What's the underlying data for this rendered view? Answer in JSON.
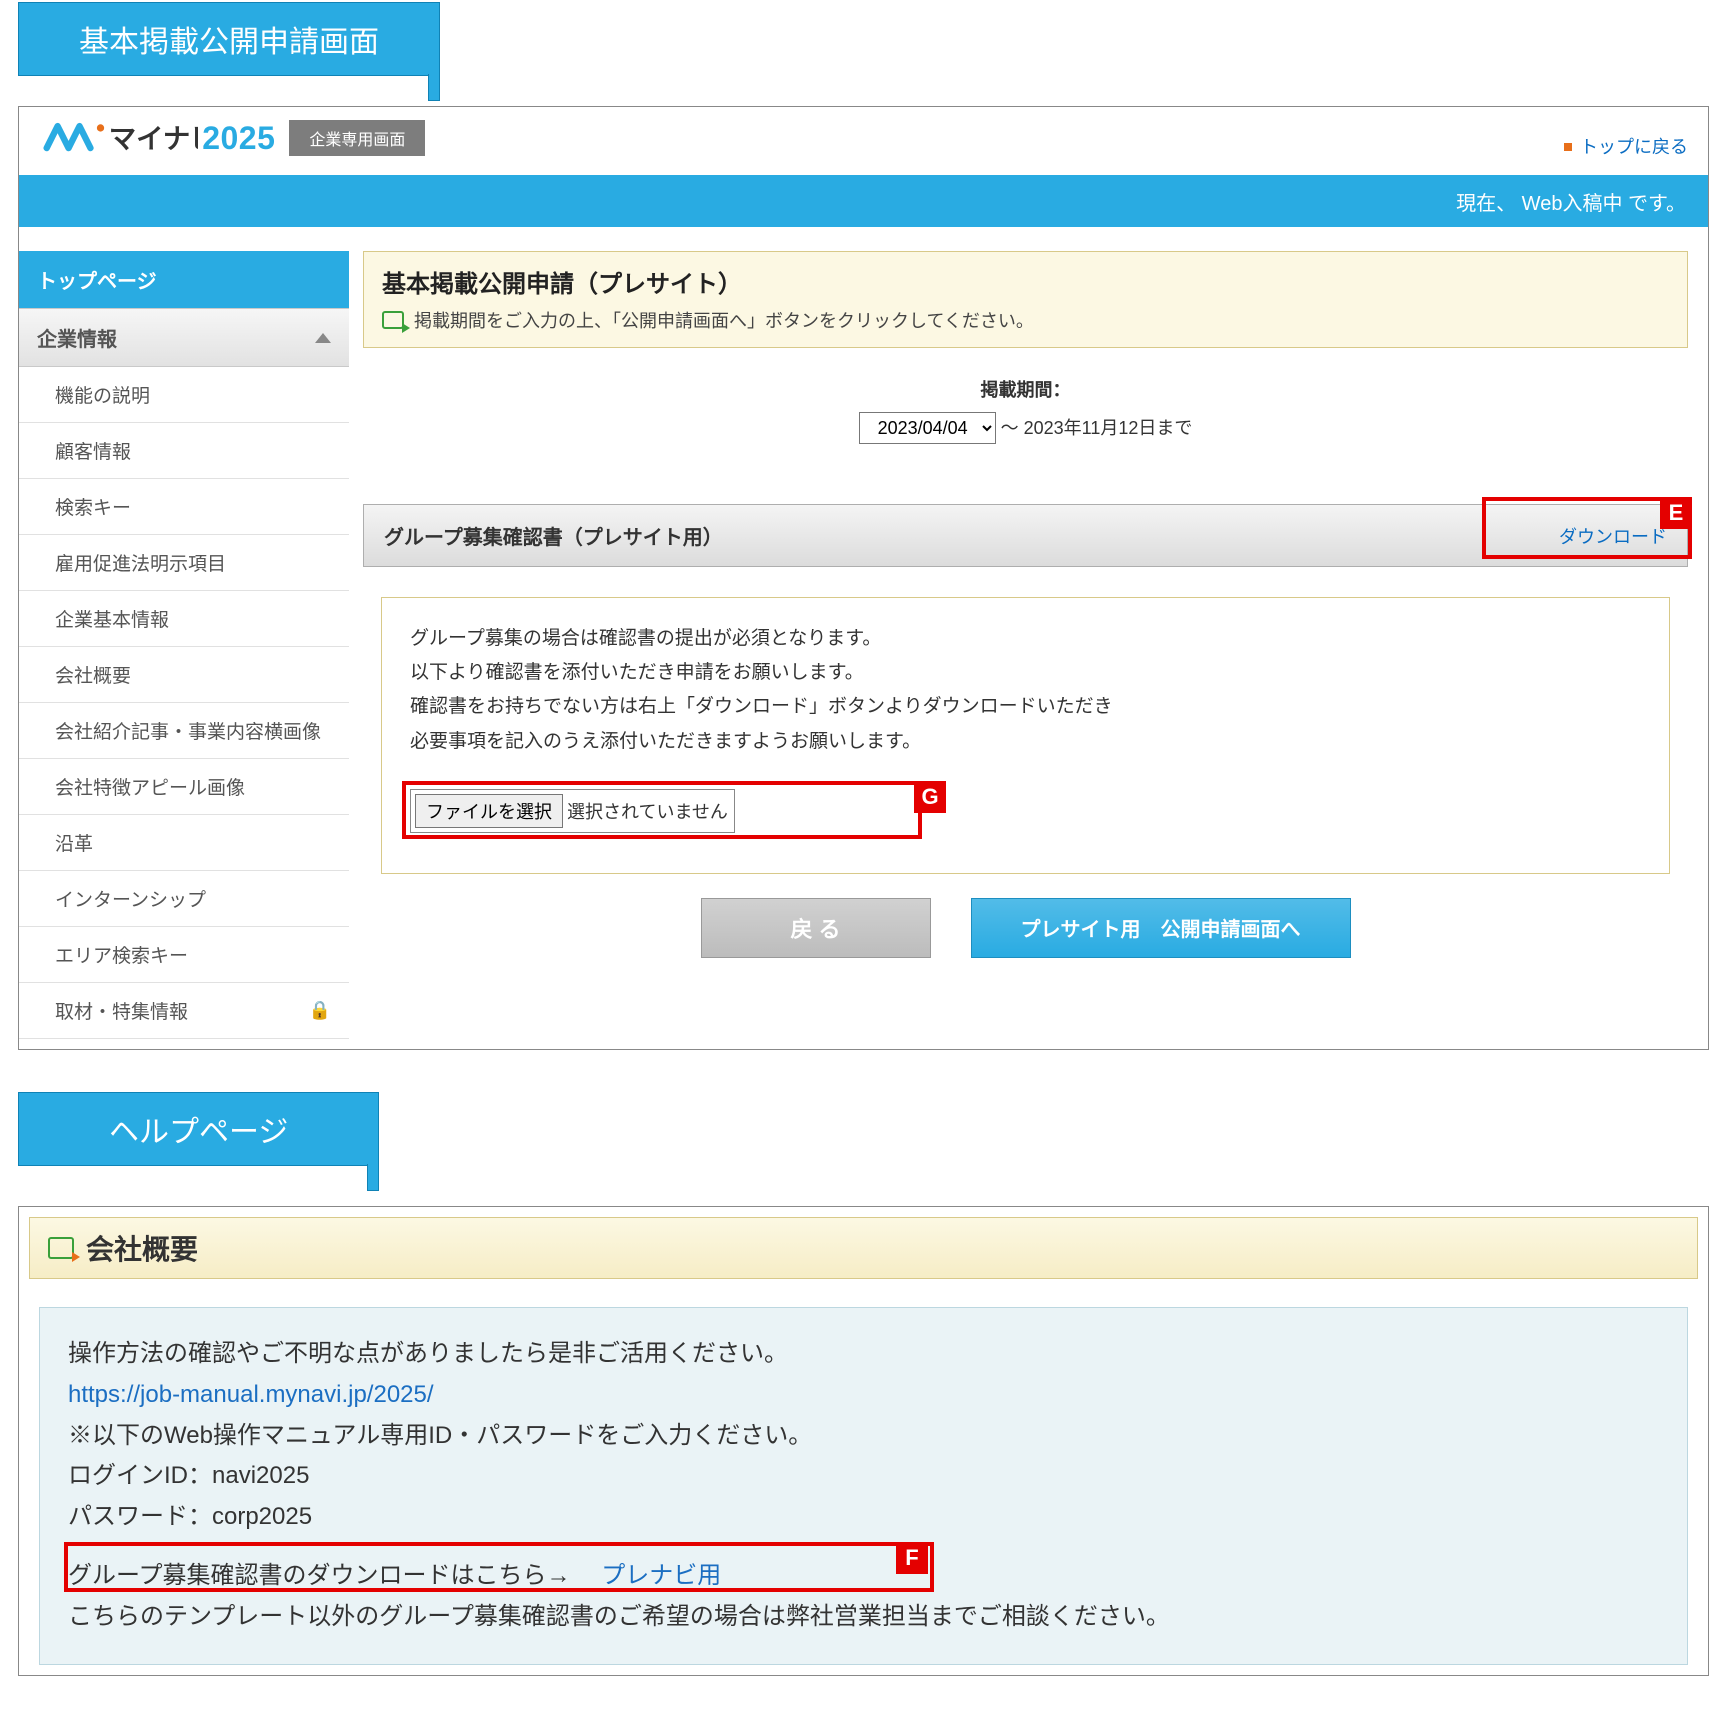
{
  "annotations": {
    "tab1": "基本掲載公開申請画面",
    "tab2": "ヘルプページ",
    "badge_e": "E",
    "badge_g": "G",
    "badge_f": "F"
  },
  "header": {
    "brand_text": "マイナビ",
    "year": "2025",
    "tag": "企業専用画面",
    "back_top": "トップに戻る",
    "status_strip": "現在、 Web入稿中 です。"
  },
  "sidebar": {
    "top": "トップページ",
    "acc": "企業情報",
    "items": [
      "機能の説明",
      "顧客情報",
      "検索キー",
      "雇用促進法明示項目",
      "企業基本情報",
      "会社概要",
      "会社紹介記事・事業内容横画像",
      "会社特徴アピール画像",
      "沿革",
      "インターンシップ",
      "エリア検索キー",
      "取材・特集情報"
    ]
  },
  "panel": {
    "title": "基本掲載公開申請（プレサイト）",
    "subtitle": "掲載期間をご入力の上、「公開申請画面へ」ボタンをクリックしてください。"
  },
  "period": {
    "label": "掲載期間：",
    "selected": "2023/04/04",
    "suffix": " ～ 2023年11月12日まで"
  },
  "section": {
    "title": "グループ募集確認書（プレサイト用）",
    "download": "ダウンロード"
  },
  "note": {
    "l1": "グループ募集の場合は確認書の提出が必須となります。",
    "l2": "以下より確認書を添付いただき申請をお願いします。",
    "l3": "確認書をお持ちでない方は右上「ダウンロード」ボタンよりダウンロードいただき",
    "l4": "必要事項を記入のうえ添付いただきますようお願いします。"
  },
  "file": {
    "button": "ファイルを選択",
    "status": "選択されていません"
  },
  "buttons": {
    "back": "戻 る",
    "next": "プレサイト用　公開申請画面へ"
  },
  "help": {
    "title": "会社概要",
    "l1": "操作方法の確認やご不明な点がありましたら是非ご活用ください。",
    "link": "https://job-manual.mynavi.jp/2025/",
    "l2": "※以下のWeb操作マニュアル専用ID・パスワードをご入力ください。",
    "l3": "ログインID：navi2025",
    "l4": "パスワード：corp2025",
    "l5a": "グループ募集確認書のダウンロードはこちら→　",
    "l5link": "プレナビ用",
    "l6": "こちらのテンプレート以外のグループ募集確認書のご希望の場合は弊社営業担当までご相談ください。"
  }
}
